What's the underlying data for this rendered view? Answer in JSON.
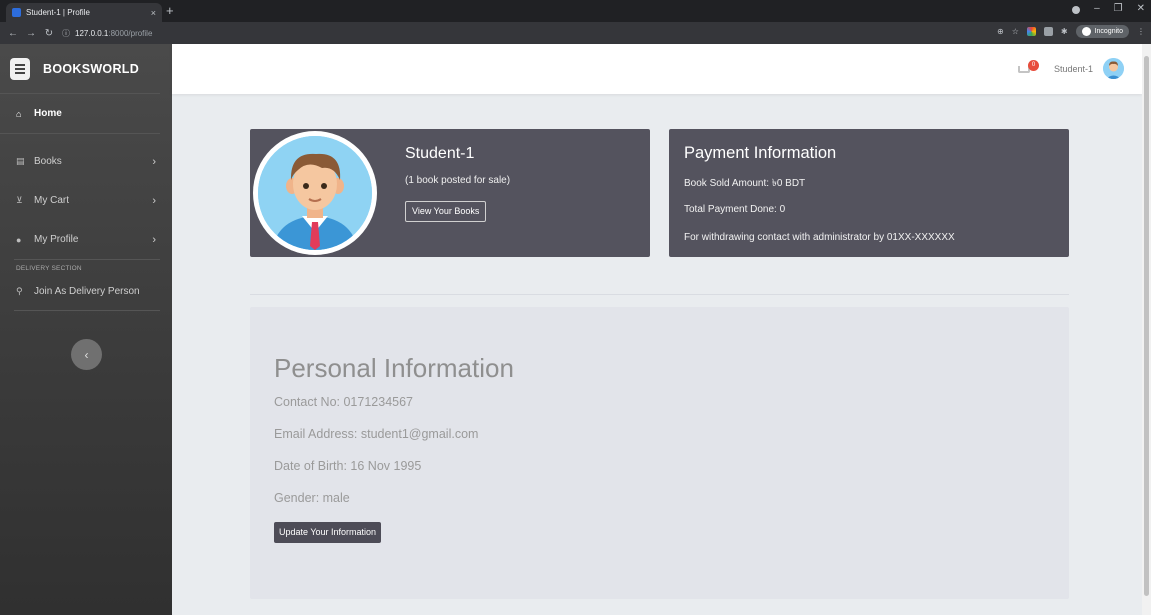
{
  "browser": {
    "tab_title": "Student-1 | Profile",
    "tab_close": "×",
    "new_tab": "+",
    "url_host": "127.0.0.1",
    "url_path": ":8000/profile",
    "incognito_label": "Incognito",
    "window_controls": [
      "–",
      "❐",
      "✕"
    ]
  },
  "sidebar": {
    "brand": "BOOKSWORLD",
    "home": "Home",
    "items": [
      {
        "label": "Books",
        "icon": "book-icon"
      },
      {
        "label": "My Cart",
        "icon": "cart-icon"
      },
      {
        "label": "My Profile",
        "icon": "user-icon"
      }
    ],
    "section_heading": "DELIVERY SECTION",
    "delivery_item": "Join As Delivery Person",
    "chevron": "›",
    "collapse": "‹"
  },
  "navbar": {
    "cart_count": "0",
    "user_name": "Student-1"
  },
  "profile": {
    "name": "Student-1",
    "subtitle": "(1 book posted for sale)",
    "view_books_label": "View Your Books"
  },
  "payment": {
    "title": "Payment Information",
    "sold_amount": "Book Sold Amount: ৳0 BDT",
    "total_payment": "Total Payment Done: 0",
    "withdraw_note": "For withdrawing contact with administrator by 01XX-XXXXXX"
  },
  "personal": {
    "title": "Personal Information",
    "contact": "Contact No: 0171234567",
    "email": "Email Address: student1@gmail.com",
    "dob": "Date of Birth: 16 Nov 1995",
    "gender": "Gender: male",
    "update_label": "Update Your Information"
  },
  "colors": {
    "sidebar_bg": "#3e3e3e",
    "card_dark": "#54535e",
    "panel_bg": "#e2e4ea",
    "badge": "#e74c3c"
  }
}
